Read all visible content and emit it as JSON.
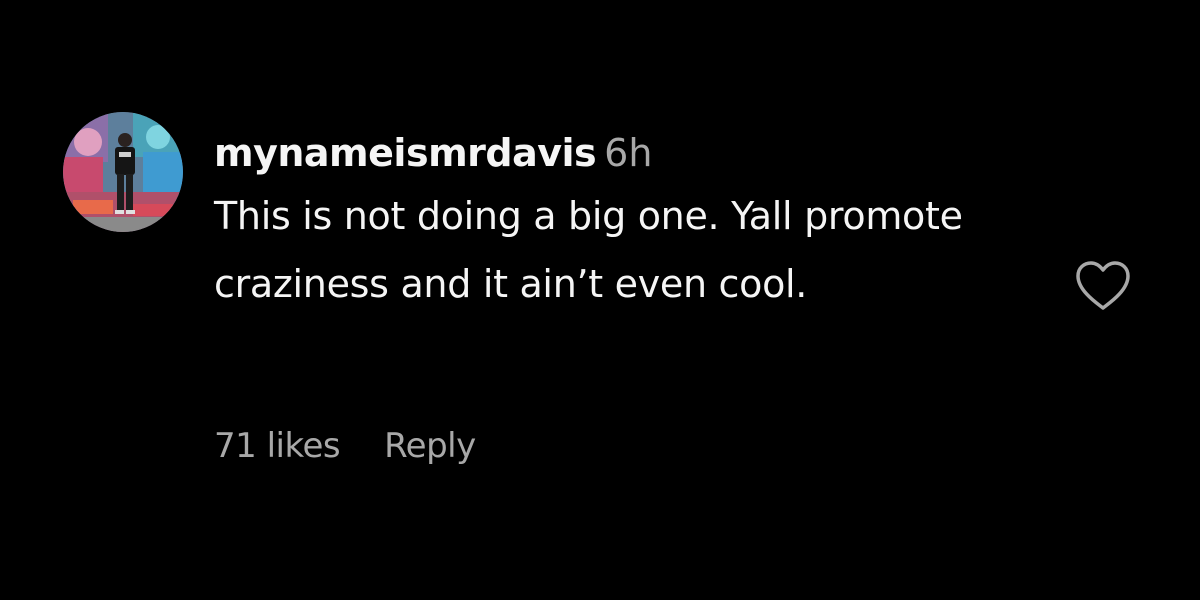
{
  "comment": {
    "username": "mynameismrdavis",
    "timestamp": "6h",
    "text": "This is not doing a big one. Yall promote craziness and it ain’t even cool.",
    "likes": "71 likes",
    "reply_label": "Reply"
  },
  "icons": {
    "like": "heart-outline-icon",
    "avatar": "profile-picture"
  },
  "colors": {
    "background": "#000000",
    "primary_text": "#f5f5f5",
    "secondary_text": "#a8a8a8"
  }
}
